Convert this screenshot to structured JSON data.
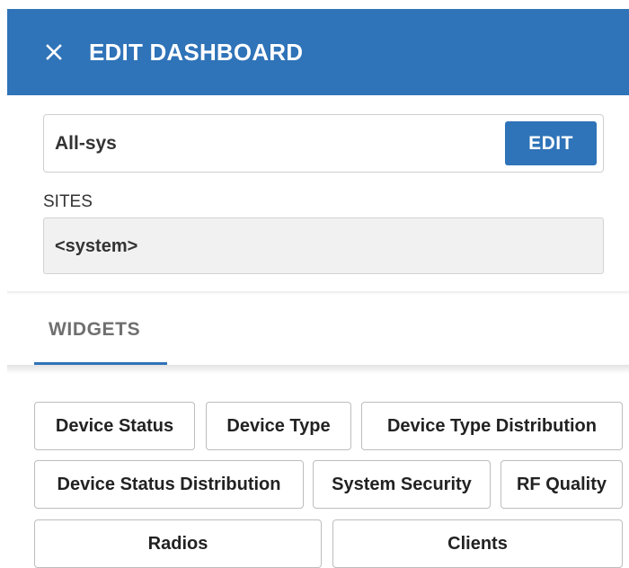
{
  "header": {
    "title": "EDIT DASHBOARD",
    "close_icon": "close-icon",
    "background": "#2f73b8"
  },
  "dashboard": {
    "name": "All-sys",
    "edit_label": "EDIT"
  },
  "sites": {
    "label": "SITES",
    "value": "<system>"
  },
  "tabs": [
    {
      "label": "WIDGETS",
      "active": true
    }
  ],
  "widgets": [
    {
      "label": "Device Status"
    },
    {
      "label": "Device Type"
    },
    {
      "label": "Device Type Distribution"
    },
    {
      "label": "Device Status Distribution"
    },
    {
      "label": "System Security"
    },
    {
      "label": "RF Quality"
    },
    {
      "label": "Radios"
    },
    {
      "label": "Clients"
    }
  ],
  "colors": {
    "accent": "#2f73b8",
    "text": "#333333",
    "tab_text": "#6f6f6f"
  }
}
